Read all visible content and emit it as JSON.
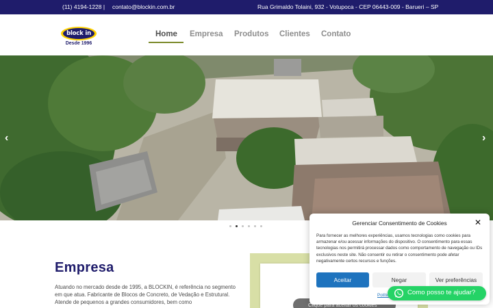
{
  "topbar": {
    "phone": "(11) 4194-1228 |",
    "email": "contato@blockin.com.br",
    "address": "Rua Grimaldo Tolaini, 932 - Votupoca - CEP 06443-009 - Barueri – SP",
    "background_color": "#1f1c6b"
  },
  "logo": {
    "text": "block in",
    "tagline": "Desde 1996",
    "colors": {
      "oval": "#ffd200",
      "inner": "#1f1c6b"
    }
  },
  "nav": {
    "items": [
      {
        "label": "Home",
        "active": true
      },
      {
        "label": "Empresa",
        "active": false
      },
      {
        "label": "Produtos",
        "active": false
      },
      {
        "label": "Clientes",
        "active": false
      },
      {
        "label": "Contato",
        "active": false
      }
    ],
    "accent_color": "#7b8a2a"
  },
  "slider": {
    "prev_icon": "chevron-left-icon",
    "next_icon": "chevron-right-icon",
    "slide_count": 6,
    "active_slide": 2
  },
  "empresa": {
    "title": "Empresa",
    "text": "Atuando no mercado desde de 1995, a BLOCKIN, é referência no segmento em que atua. Fabricante de Blocos de Concreto, de Vedação e Estrutural. Atende de pequenos a grandes consumidores, bem como",
    "title_color": "#1f1c6b"
  },
  "video": {
    "placeholder_text": "Clique para aceitar os cookies"
  },
  "cookie_banner": {
    "title": "Gerenciar Consentimento de Cookies",
    "text": "Para fornecer as melhores experiências, usamos tecnologias como cookies para armazenar e/ou acessar informações do dispositivo. O consentimento para essas tecnologias nos permitirá processar dados como comportamento de navegação ou IDs exclusivos neste site. Não consentir ou retirar o consentimento pode afetar negativamente certos recursos e funções.",
    "accept_label": "Aceitar",
    "deny_label": "Negar",
    "preferences_label": "Ver preferências",
    "policy_link": "Política",
    "accent_color": "#1e73be"
  },
  "whatsapp": {
    "label": "Como posso te ajudar?",
    "color": "#25d366"
  }
}
